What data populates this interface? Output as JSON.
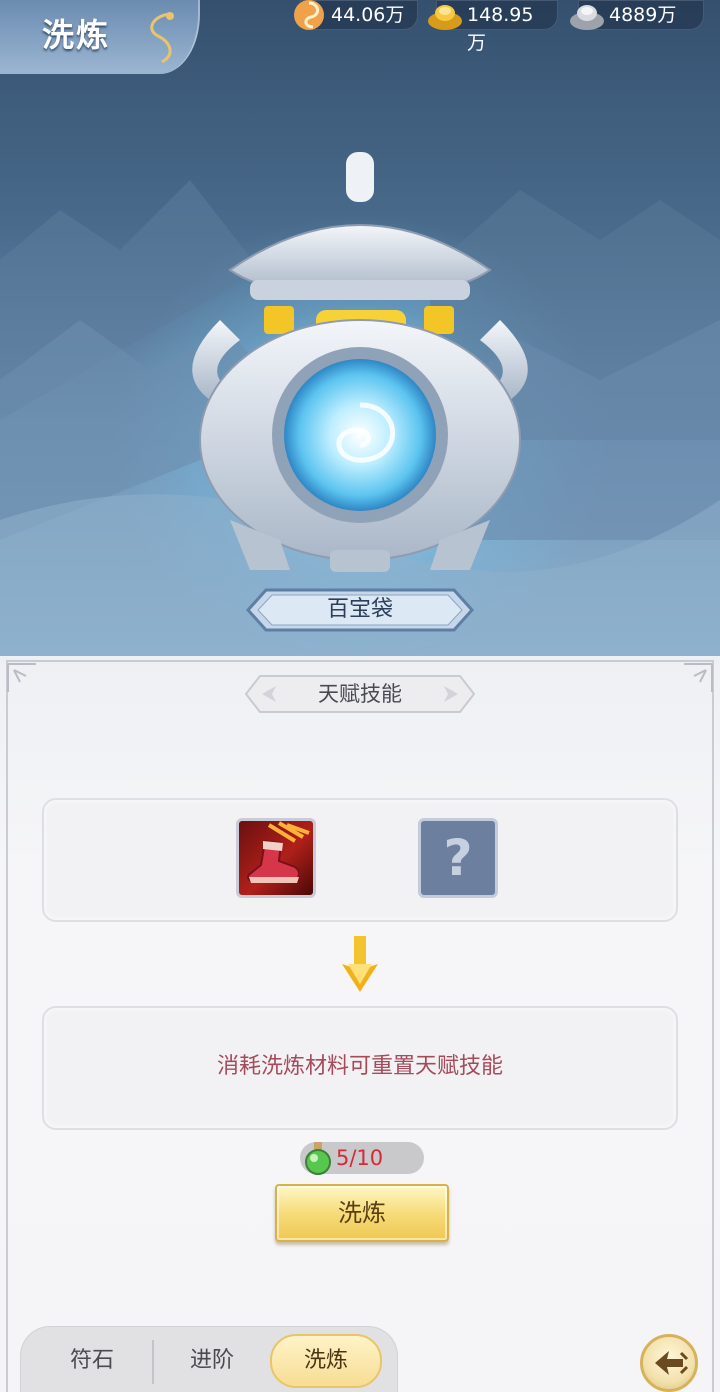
{
  "header": {
    "title": "洗炼"
  },
  "currencies": [
    {
      "icon": "jade-swirl-coin-icon",
      "value": "44.06万"
    },
    {
      "icon": "gold-ingot-icon",
      "value": "148.95万"
    },
    {
      "icon": "silver-ingot-icon",
      "value": "4889万"
    }
  ],
  "item": {
    "name": "百宝袋"
  },
  "section": {
    "title": "天赋技能"
  },
  "skills": {
    "current_icon": "red-boot-skill-icon",
    "new_icon": "question-mark-icon",
    "unknown_symbol": "?"
  },
  "description": "消耗洗炼材料可重置天赋技能",
  "material": {
    "icon": "green-potion-icon",
    "count": "5/10"
  },
  "actions": {
    "refine_label": "洗炼"
  },
  "tabs": [
    {
      "label": "符石",
      "active": false
    },
    {
      "label": "进阶",
      "active": false
    },
    {
      "label": "洗炼",
      "active": true
    }
  ],
  "colors": {
    "description_text": "#a64b5a",
    "counter_text": "#d8283a",
    "button_gold": "#f6dc7a"
  }
}
